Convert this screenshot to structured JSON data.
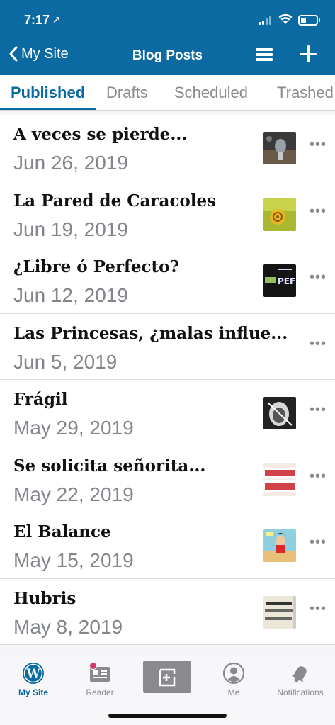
{
  "status": {
    "time": "7:17"
  },
  "nav": {
    "back_label": "My Site",
    "title": "Blog Posts"
  },
  "tabs": [
    {
      "label": "Published"
    },
    {
      "label": "Drafts"
    },
    {
      "label": "Scheduled"
    },
    {
      "label": "Trashed"
    }
  ],
  "posts": [
    {
      "title": "A veces se pierde...",
      "date": "Jun 26, 2019",
      "thumb": "dark-statue-photo"
    },
    {
      "title": "La Pared de Caracoles",
      "date": "Jun 19, 2019",
      "thumb": "snail-photo"
    },
    {
      "title": "¿Libre ó Perfecto?",
      "date": "Jun 12, 2019",
      "thumb": "neon-sign-photo"
    },
    {
      "title": "Las Princesas, ¿malas influe...",
      "date": "Jun 5, 2019",
      "thumb": ""
    },
    {
      "title": "Frágil",
      "date": "May 29, 2019",
      "thumb": "bw-face-photo"
    },
    {
      "title": "Se solicita señorita...",
      "date": "May 22, 2019",
      "thumb": "newspaper-ad-image"
    },
    {
      "title": "El Balance",
      "date": "May 15, 2019",
      "thumb": "comic-woman-image"
    },
    {
      "title": "Hubris",
      "date": "May 8, 2019",
      "thumb": "dictionary-text-image"
    }
  ],
  "tabbar": [
    {
      "label": "My Site",
      "icon": "wordpress-icon"
    },
    {
      "label": "Reader",
      "icon": "reader-icon"
    },
    {
      "label": "",
      "icon": "compose-post-icon"
    },
    {
      "label": "Me",
      "icon": "profile-icon"
    },
    {
      "label": "Notifications",
      "icon": "bell-icon"
    }
  ],
  "colors": {
    "brand": "#0a6aa1",
    "badge": "#d63a6d"
  }
}
